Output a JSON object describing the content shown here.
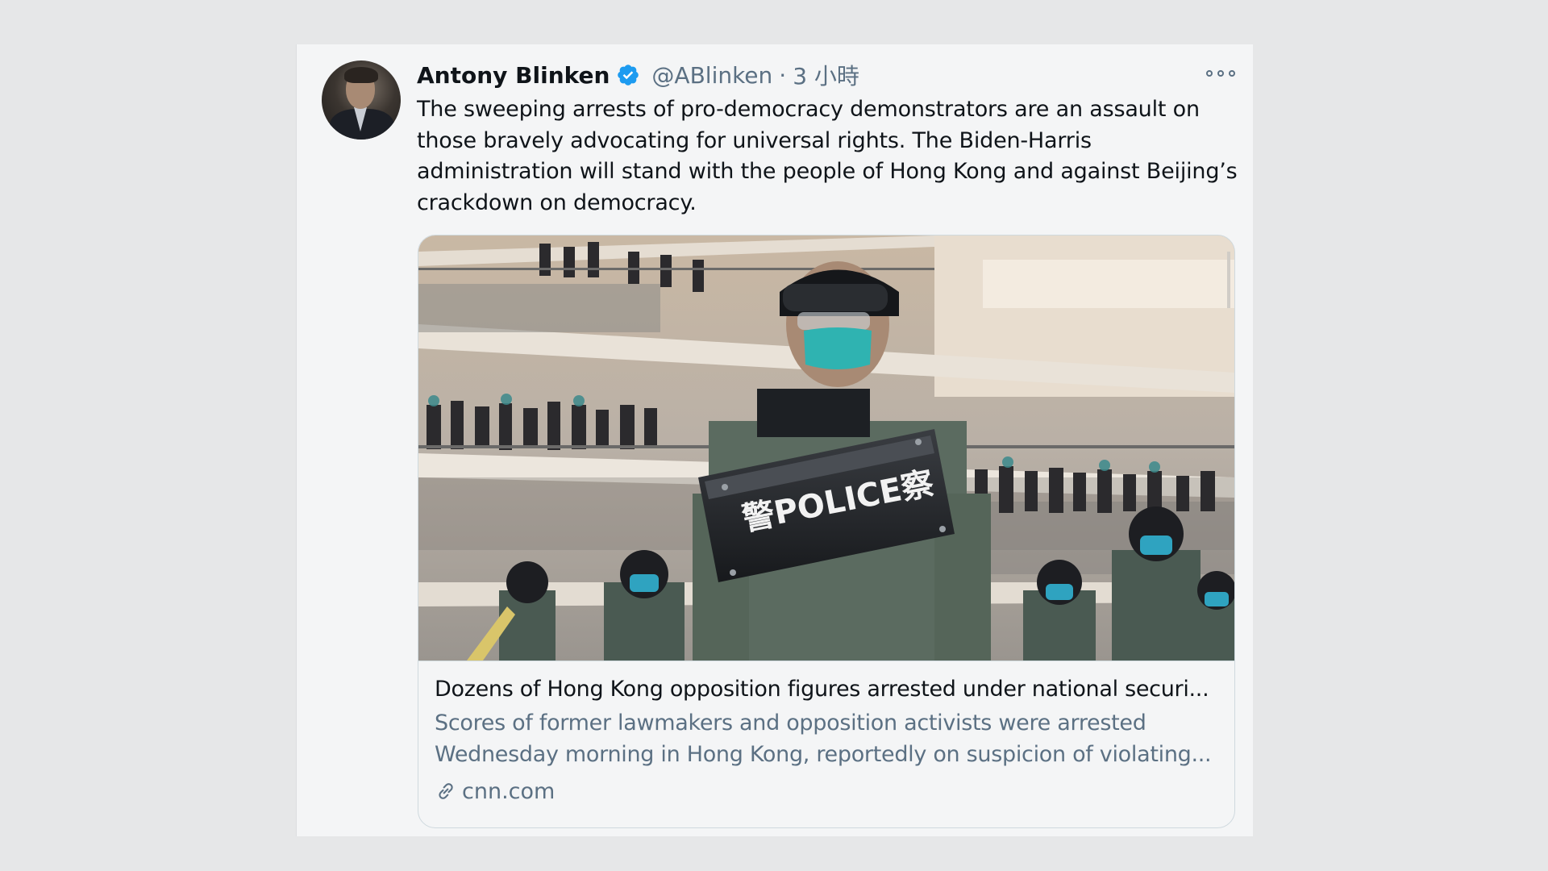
{
  "tweet": {
    "author_name": "Antony Blinken",
    "handle": "@ABlinken",
    "separator": "·",
    "time": "3 小時",
    "verified_icon": "verified-badge-icon",
    "more_icon": "more-options-icon",
    "text_lines": [
      "The sweeping arrests of pro-democracy demonstrators are an assault on",
      "those bravely advocating for universal rights. The Biden-Harris",
      "administration will stand with the people of Hong Kong and against Beijing’s",
      "crackdown on democracy."
    ]
  },
  "link_card": {
    "image_badge_text": "警POLICE察",
    "title": "Dozens of Hong Kong opposition figures arrested under national securi...",
    "description_lines": [
      "Scores of former lawmakers and opposition activists were arrested",
      "Wednesday morning in Hong Kong, reportedly on suspicion of violating..."
    ],
    "domain": "cnn.com",
    "link_icon": "link-icon"
  },
  "colors": {
    "background": "#e6e7e8",
    "tweet_background": "#f4f5f6",
    "primary_text": "#0f1419",
    "secondary_text": "#5b7083",
    "verified_blue": "#1d9bf0",
    "card_border": "#cfd9de"
  }
}
